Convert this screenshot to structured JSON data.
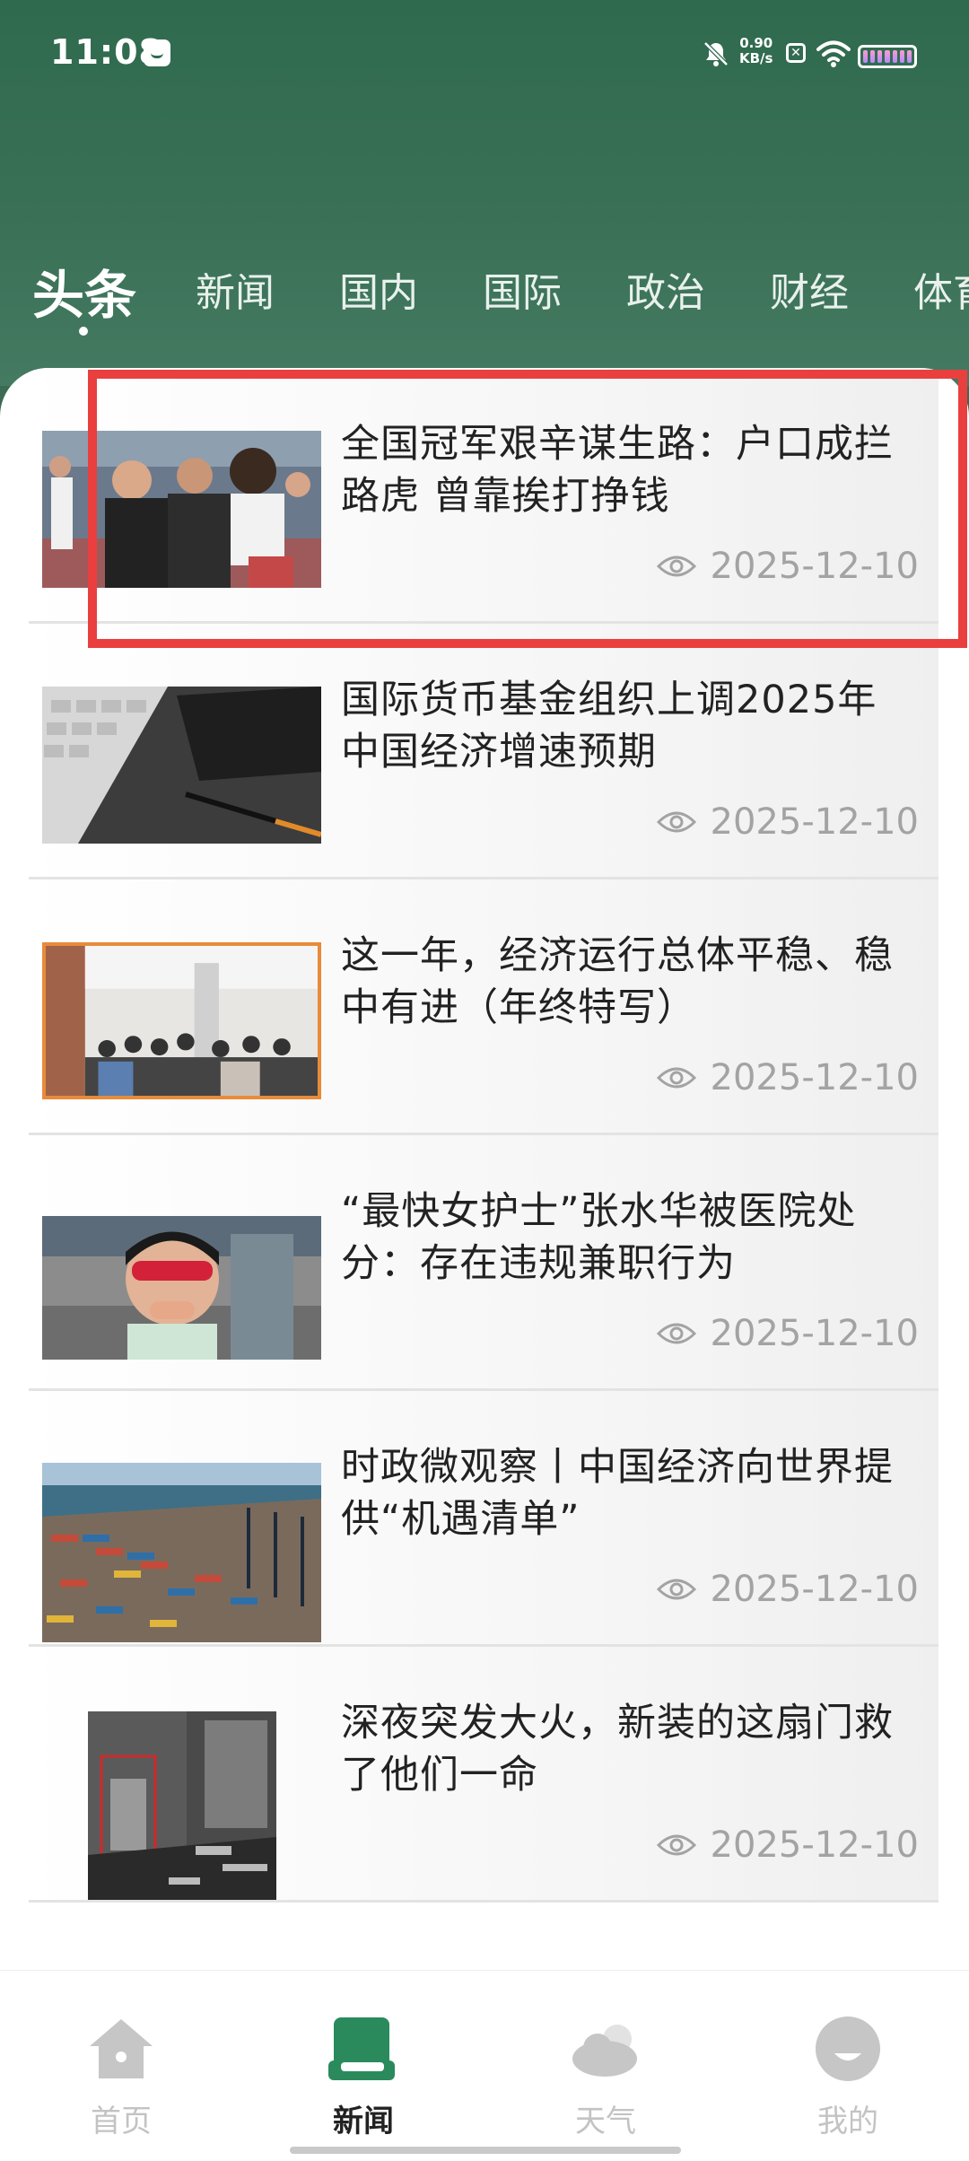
{
  "status_bar": {
    "time": "11:08",
    "speed_value": "0.90",
    "speed_unit": "KB/s",
    "icons": [
      "message-icon",
      "mute-icon",
      "x-icon",
      "wifi-icon",
      "battery-icon"
    ]
  },
  "tabs": [
    {
      "label": "头条",
      "active": true
    },
    {
      "label": "新闻"
    },
    {
      "label": "国内"
    },
    {
      "label": "国际"
    },
    {
      "label": "政治"
    },
    {
      "label": "财经"
    },
    {
      "label": "体育"
    }
  ],
  "news": [
    {
      "title": "全国冠军艰辛谋生路：户口成拦路虎 曾靠挨打挣钱",
      "date": "2025-12-10"
    },
    {
      "title": "国际货币基金组织上调2025年中国经济增速预期",
      "date": "2025-12-10"
    },
    {
      "title": "这一年，经济运行总体平稳、稳中有进（年终特写）",
      "date": "2025-12-10"
    },
    {
      "title": "“最快女护士”张水华被医院处分：存在违规兼职行为",
      "date": "2025-12-10"
    },
    {
      "title": "时政微观察丨中国经济向世界提供“机遇清单”",
      "date": "2025-12-10"
    },
    {
      "title": "深夜突发大火，新装的这扇门救了他们一命",
      "date": "2025-12-10"
    }
  ],
  "bottom_nav": [
    {
      "label": "首页",
      "icon": "home-icon"
    },
    {
      "label": "新闻",
      "icon": "news-icon",
      "active": true
    },
    {
      "label": "天气",
      "icon": "weather-icon"
    },
    {
      "label": "我的",
      "icon": "profile-icon"
    }
  ],
  "colors": {
    "header_green": "#3a7157",
    "accent_green": "#2a8a5c",
    "highlight_red": "#ea3f3f"
  }
}
